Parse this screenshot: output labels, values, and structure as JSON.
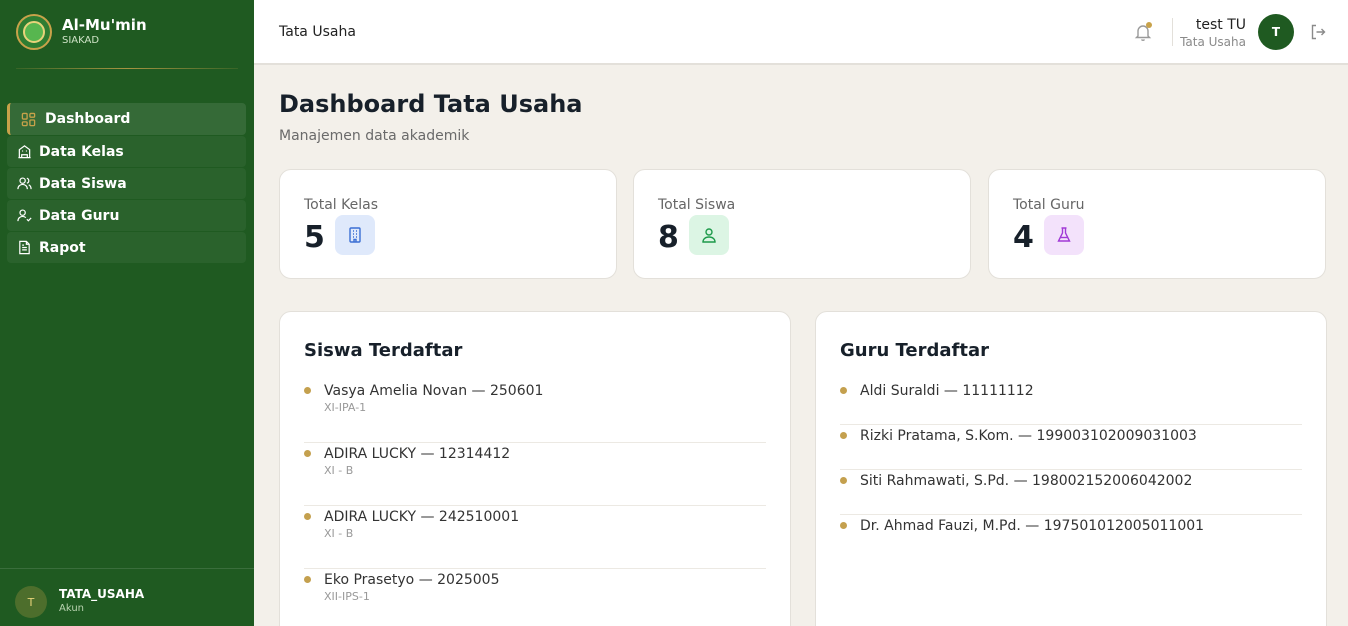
{
  "app": {
    "name": "Al-Mu'min",
    "subtitle": "SIAKAD"
  },
  "sidebar": {
    "items": [
      {
        "label": "Dashboard",
        "icon": "grid-icon",
        "active": true
      },
      {
        "label": "Data Kelas",
        "icon": "building-icon"
      },
      {
        "label": "Data Siswa",
        "icon": "users-icon"
      },
      {
        "label": "Data Guru",
        "icon": "user-check-icon"
      },
      {
        "label": "Rapot",
        "icon": "document-icon"
      }
    ],
    "footer": {
      "avatar": "T",
      "name": "TATA_USAHA",
      "role": "Akun"
    }
  },
  "topbar": {
    "title": "Tata Usaha",
    "user_name": "test TU",
    "user_role": "Tata Usaha",
    "avatar": "T"
  },
  "page": {
    "title": "Dashboard Tata Usaha",
    "subtitle": "Manajemen data akademik"
  },
  "stats": [
    {
      "label": "Total Kelas",
      "value": "5",
      "icon": "building-icon",
      "color": "#3b6fd4",
      "bg": "#dfe9fb"
    },
    {
      "label": "Total Siswa",
      "value": "8",
      "icon": "users-icon",
      "color": "#1d9a4a",
      "bg": "#dcf5e4"
    },
    {
      "label": "Total Guru",
      "value": "4",
      "icon": "flask-icon",
      "color": "#a13ad6",
      "bg": "#f3e2fb"
    }
  ],
  "siswa": {
    "title": "Siswa Terdaftar",
    "items": [
      {
        "name": "Vasya Amelia Novan — 250601",
        "class": "XI-IPA-1"
      },
      {
        "name": "ADIRA LUCKY — 12314412",
        "class": "XI - B"
      },
      {
        "name": "ADIRA LUCKY — 242510001",
        "class": "XI - B"
      },
      {
        "name": "Eko Prasetyo — 2025005",
        "class": "XII-IPS-1"
      }
    ]
  },
  "guru": {
    "title": "Guru Terdaftar",
    "items": [
      {
        "name": "Aldi Suraldi — 11111112"
      },
      {
        "name": "Rizki Pratama, S.Kom. — 199003102009031003"
      },
      {
        "name": "Siti Rahmawati, S.Pd. — 198002152006042002"
      },
      {
        "name": "Dr. Ahmad Fauzi, M.Pd. — 197501012005011001"
      }
    ]
  },
  "colors": {
    "sidebar": "#1f5a21",
    "accent": "#c8a24a",
    "background": "#f3f0ea"
  }
}
